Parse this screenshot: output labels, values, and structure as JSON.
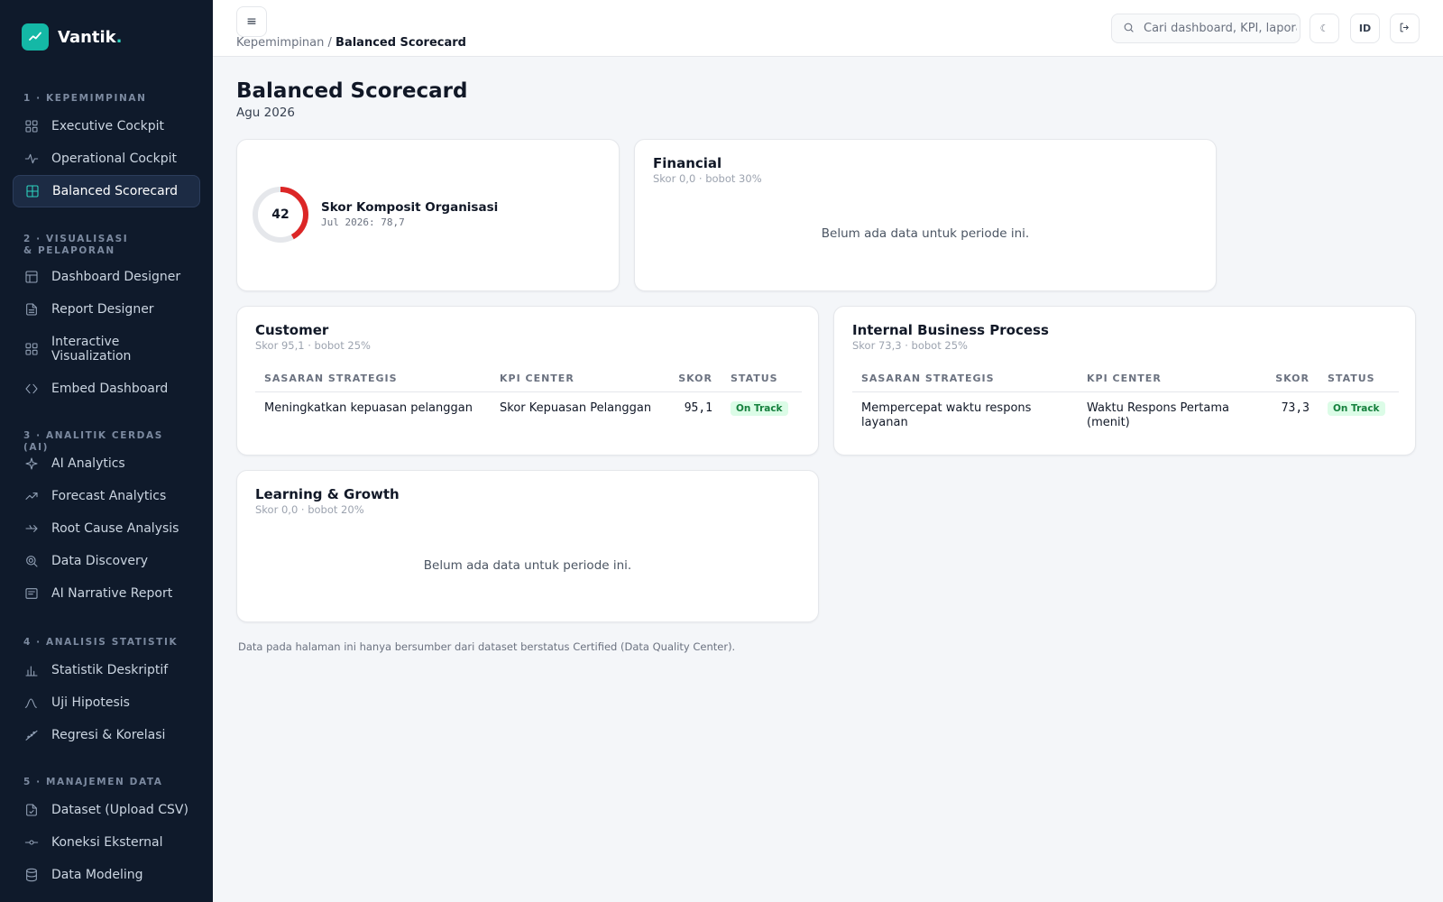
{
  "brand": {
    "name": "Vantik",
    "dot": "."
  },
  "sidebar": {
    "sections": [
      {
        "title": "1 · Kepemimpinan",
        "items": [
          {
            "label": "Executive Cockpit",
            "icon": "grid-icon"
          },
          {
            "label": "Operational Cockpit",
            "icon": "pulse-icon"
          },
          {
            "label": "Balanced Scorecard",
            "icon": "table-icon",
            "active": true
          }
        ]
      },
      {
        "title": "2 · Visualisasi & Pelaporan",
        "items": [
          {
            "label": "Dashboard Designer",
            "icon": "layout-icon"
          },
          {
            "label": "Report Designer",
            "icon": "file-icon"
          },
          {
            "label": "Interactive Visualization",
            "icon": "grid-icon"
          },
          {
            "label": "Embed Dashboard",
            "icon": "code-icon"
          }
        ]
      },
      {
        "title": "3 · Analitik Cerdas (AI)",
        "items": [
          {
            "label": "AI Analytics",
            "icon": "sparkle-icon"
          },
          {
            "label": "Forecast Analytics",
            "icon": "trend-icon"
          },
          {
            "label": "Root Cause Analysis",
            "icon": "split-arrow-icon"
          },
          {
            "label": "Data Discovery",
            "icon": "search-target-icon"
          },
          {
            "label": "AI Narrative Report",
            "icon": "note-icon"
          }
        ]
      },
      {
        "title": "4 · Analisis Statistik",
        "items": [
          {
            "label": "Statistik Deskriptif",
            "icon": "bar-chart-icon"
          },
          {
            "label": "Uji Hipotesis",
            "icon": "curve-icon"
          },
          {
            "label": "Regresi & Korelasi",
            "icon": "regression-icon"
          }
        ]
      },
      {
        "title": "5 · Manajemen Data",
        "items": [
          {
            "label": "Dataset (Upload CSV)",
            "icon": "csv-file-icon"
          },
          {
            "label": "Koneksi Eksternal",
            "icon": "connection-icon"
          },
          {
            "label": "Data Modeling",
            "icon": "database-icon"
          }
        ]
      }
    ]
  },
  "topbar": {
    "menu_icon": "≡",
    "breadcrumb": {
      "parent": "Kepemimpinan",
      "separator": " / ",
      "current": "Balanced Scorecard"
    },
    "search_placeholder": "Cari dashboard, KPI, laporan",
    "theme_glyph": "☾",
    "lang_label": "ID"
  },
  "page": {
    "title": "Balanced Scorecard",
    "period": "Agu 2026"
  },
  "composite": {
    "score_label": "42",
    "score_value": 42,
    "title": "Skor Komposit Organisasi",
    "previous": "Jul 2026: 78,7",
    "color": "#dc2626"
  },
  "financial": {
    "title": "Financial",
    "subtitle": "Skor 0,0 · bobot 30%",
    "empty": "Belum ada data untuk periode ini."
  },
  "customer": {
    "title": "Customer",
    "subtitle": "Skor 95,1 · bobot 25%",
    "columns": [
      "Sasaran Strategis",
      "KPI Center",
      "Skor",
      "Status"
    ],
    "rows": [
      {
        "objective": "Meningkatkan kepuasan pelanggan",
        "kpi": "Skor Kepuasan Pelanggan",
        "score": "95,1",
        "status": "On Track"
      }
    ]
  },
  "internal": {
    "title": "Internal Business Process",
    "subtitle": "Skor 73,3 · bobot 25%",
    "columns": [
      "Sasaran Strategis",
      "KPI Center",
      "Skor",
      "Status"
    ],
    "rows": [
      {
        "objective": "Mempercepat waktu respons layanan",
        "kpi": "Waktu Respons Pertama (menit)",
        "score": "73,3",
        "status": "On Track"
      }
    ]
  },
  "learning": {
    "title": "Learning & Growth",
    "subtitle": "Skor 0,0 · bobot 20%",
    "empty": "Belum ada data untuk periode ini."
  },
  "footnote": "Data pada halaman ini hanya bersumber dari dataset berstatus Certified (Data Quality Center).",
  "colors": {
    "accent": "#14b8a6",
    "sidebar_bg": "#0f1a2b",
    "on_track_bg": "#dcfce7",
    "on_track_text": "#15803d"
  }
}
